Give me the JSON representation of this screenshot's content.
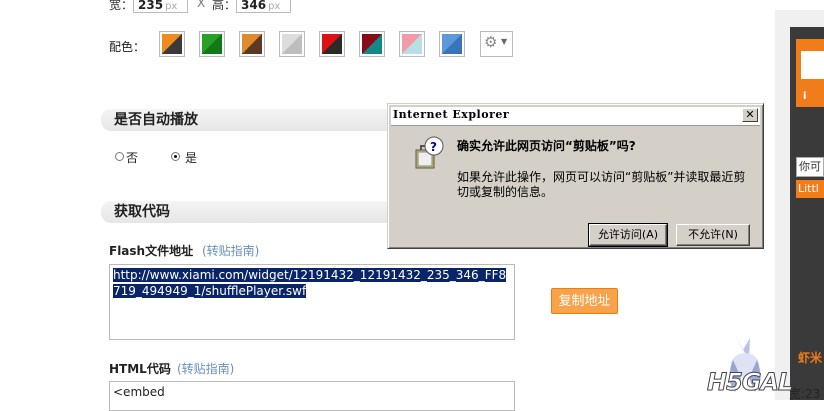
{
  "dimensions": {
    "width_label": "宽：",
    "width_value": "235",
    "unit": "px",
    "x_sep": "X",
    "height_label": "高：",
    "height_value": "346"
  },
  "colors": {
    "label": "配色：",
    "swatches": [
      {
        "name": "orange-black",
        "c1": "#f08a1c",
        "c2": "#3a3a3a"
      },
      {
        "name": "green",
        "c1": "#27a12a",
        "c2": "#0f7a16"
      },
      {
        "name": "orange-brown",
        "c1": "#e08a30",
        "c2": "#5a3a22"
      },
      {
        "name": "light-gray",
        "c1": "#dcdcdc",
        "c2": "#bdbdbd"
      },
      {
        "name": "red-black",
        "c1": "#e01010",
        "c2": "#2a2a2a"
      },
      {
        "name": "maroon-teal",
        "c1": "#8a0a18",
        "c2": "#12888a"
      },
      {
        "name": "pink-cyan",
        "c1": "#f29aa6",
        "c2": "#b8e0e4"
      },
      {
        "name": "blue",
        "c1": "#5a9ad8",
        "c2": "#3a74b8"
      }
    ],
    "custom_icon": "gear-icon"
  },
  "autoplay": {
    "title": "是否自动播放",
    "option_no": "否",
    "option_yes": "是"
  },
  "get_code": {
    "title": "获取代码",
    "flash_label": "Flash文件地址",
    "flash_guide": "(转贴指南)",
    "flash_url": "http://www.xiami.com/widget/12191432_12191432_235_346_FF8719_494949_1/shufflePlayer.swf",
    "copy_button": "复制地址",
    "html_label": "HTML代码",
    "html_guide": "(转贴指南)",
    "html_value": "<embed"
  },
  "dialog": {
    "title": "Internet Explorer",
    "close": "✕",
    "question": "确实允许此网页访问“剪贴板”吗?",
    "message": "如果允许此操作，网页可以访问“剪贴板”并读取最近剪切或复制的信息。",
    "allow_button": "允许访问(A)",
    "deny_button": "不允许(N)"
  },
  "right_panel": {
    "text1": "你可",
    "text2": "Littl",
    "bottom_text": "宽:23",
    "logo": "虾米"
  },
  "watermark": "H5GAL"
}
